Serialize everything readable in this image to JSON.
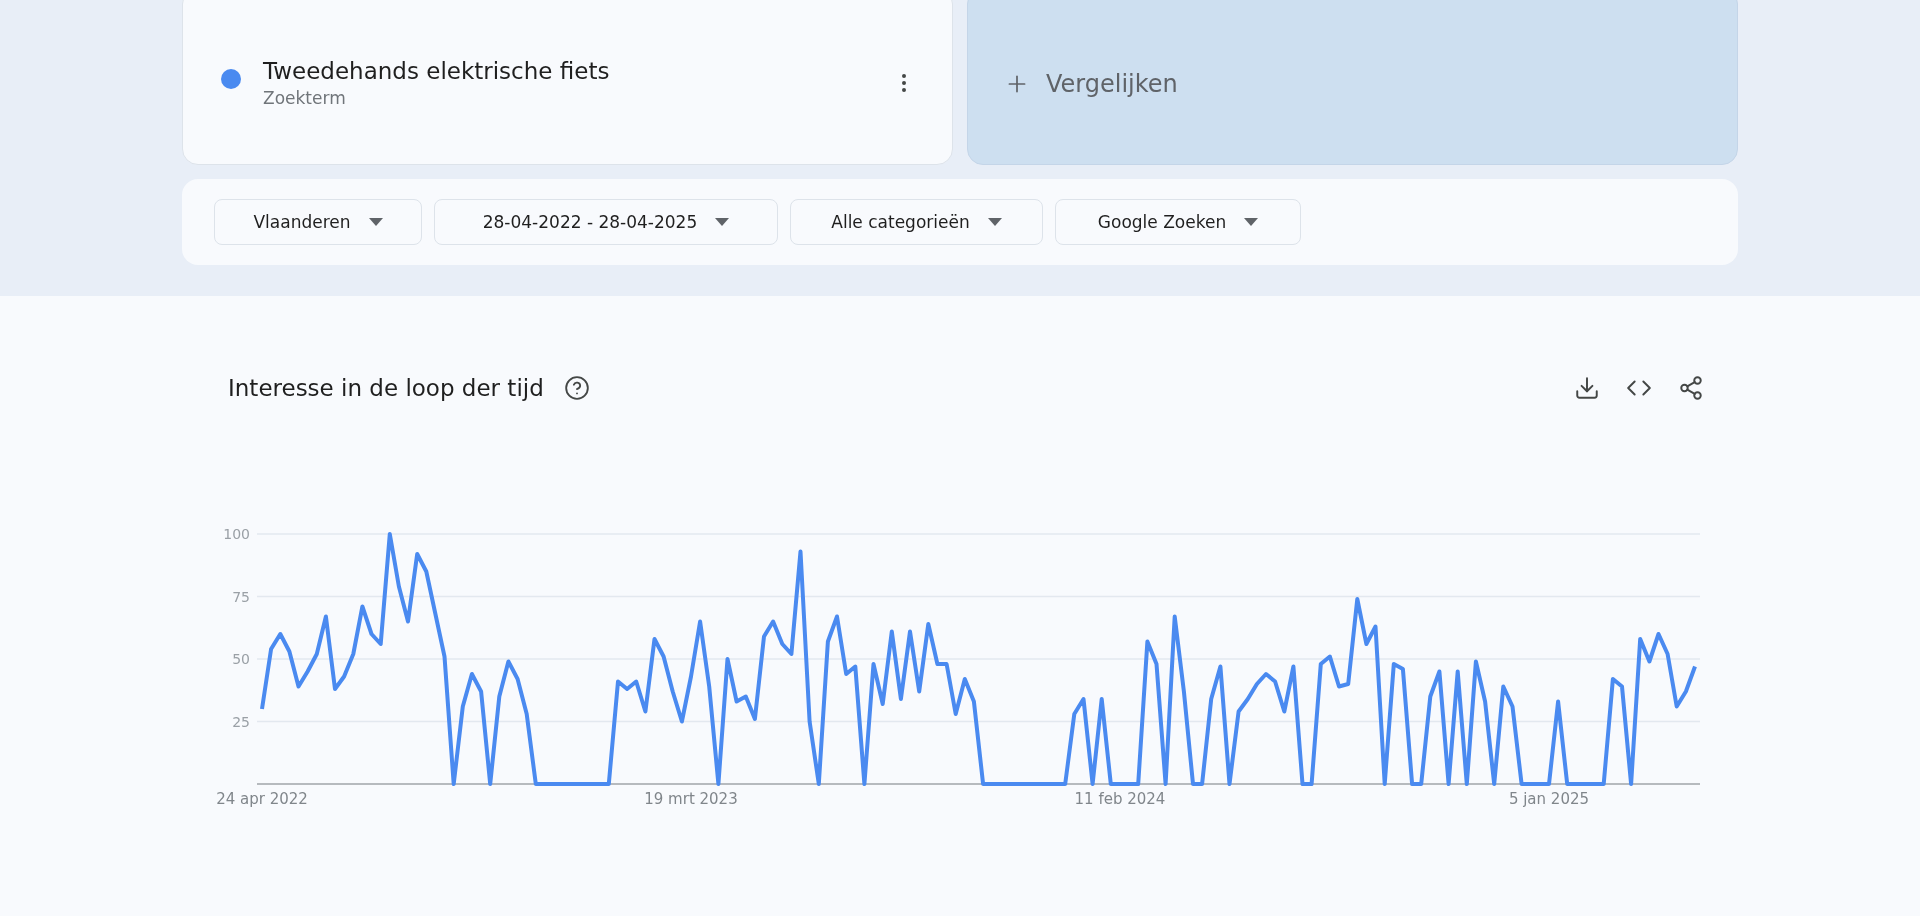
{
  "search_term": {
    "title": "Tweedehands elektrische fiets",
    "subtitle": "Zoekterm",
    "color": "#4a8af0"
  },
  "compare": {
    "label": "Vergelijken"
  },
  "filters": [
    {
      "label": "Vlaanderen"
    },
    {
      "label": "28-04-2022 - 28-04-2025"
    },
    {
      "label": "Alle categorieën"
    },
    {
      "label": "Google Zoeken"
    }
  ],
  "interest_section": {
    "title": "Interesse in de loop der tijd",
    "chart_data": {
      "type": "line",
      "ylim": [
        0,
        100
      ],
      "yticks": [
        25,
        50,
        75,
        100
      ],
      "grid": true,
      "categories": [
        "24 apr 2022",
        null,
        null,
        null,
        null,
        null,
        null,
        null,
        null,
        null,
        null,
        null,
        null,
        null,
        null,
        null,
        null,
        null,
        null,
        null,
        null,
        null,
        null,
        null,
        null,
        null,
        null,
        null,
        null,
        null,
        null,
        null,
        null,
        null,
        null,
        null,
        null,
        null,
        null,
        null,
        null,
        null,
        null,
        null,
        null,
        null,
        null,
        "19 mrt 2023",
        null,
        null,
        null,
        null,
        null,
        null,
        null,
        null,
        null,
        null,
        null,
        null,
        null,
        null,
        null,
        null,
        null,
        null,
        null,
        null,
        null,
        null,
        null,
        null,
        null,
        null,
        null,
        null,
        null,
        null,
        null,
        null,
        null,
        null,
        null,
        null,
        null,
        null,
        null,
        null,
        null,
        null,
        null,
        null,
        null,
        null,
        "11 feb 2024",
        null,
        null,
        null,
        null,
        null,
        null,
        null,
        null,
        null,
        null,
        null,
        null,
        null,
        null,
        null,
        null,
        null,
        null,
        null,
        null,
        null,
        null,
        null,
        null,
        null,
        null,
        null,
        null,
        null,
        null,
        null,
        null,
        null,
        null,
        null,
        null,
        null,
        null,
        null,
        null,
        null,
        null,
        null,
        null,
        null,
        null,
        "5 jan 2025",
        null,
        null,
        null,
        null,
        null,
        null,
        null,
        null,
        null,
        null,
        null,
        null,
        null,
        null,
        null,
        null
      ],
      "series": [
        {
          "color": "#4a8af0",
          "values": [
            30,
            54,
            60,
            53,
            39,
            45,
            52,
            67,
            38,
            43,
            52,
            71,
            60,
            56,
            100,
            79,
            65,
            92,
            85,
            68,
            51,
            0,
            31,
            44,
            37,
            0,
            35,
            49,
            42,
            28,
            0,
            0,
            0,
            0,
            0,
            0,
            0,
            0,
            0,
            41,
            38,
            41,
            29,
            58,
            51,
            37,
            25,
            43,
            65,
            39,
            0,
            50,
            33,
            35,
            26,
            59,
            65,
            56,
            52,
            93,
            25,
            0,
            57,
            67,
            44,
            47,
            0,
            48,
            32,
            61,
            34,
            61,
            37,
            64,
            48,
            48,
            28,
            42,
            33,
            0,
            0,
            0,
            0,
            0,
            0,
            0,
            0,
            0,
            0,
            28,
            34,
            0,
            34,
            0,
            0,
            0,
            0,
            57,
            48,
            0,
            67,
            37,
            0,
            0,
            34,
            47,
            0,
            29,
            34,
            40,
            44,
            41,
            29,
            47,
            0,
            0,
            48,
            51,
            39,
            40,
            74,
            56,
            63,
            0,
            48,
            46,
            0,
            0,
            35,
            45,
            0,
            45,
            0,
            49,
            33,
            0,
            39,
            31,
            0,
            0,
            0,
            0,
            33,
            0,
            0,
            0,
            0,
            0,
            42,
            39,
            0,
            58,
            49,
            60,
            52,
            31,
            37,
            47
          ]
        }
      ]
    }
  }
}
